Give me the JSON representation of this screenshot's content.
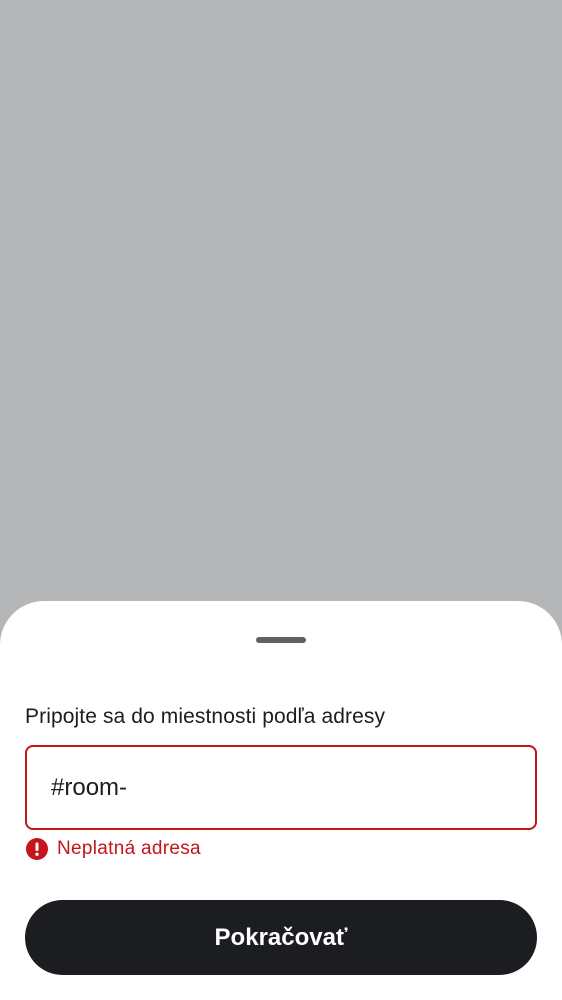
{
  "bottom_sheet": {
    "title": "Pripojte sa do miestnosti podľa adresy",
    "address_field": {
      "value": "#room-",
      "placeholder": ""
    },
    "error": {
      "icon": "error-icon",
      "message": "Neplatná adresa"
    },
    "continue_label": "Pokračovať"
  },
  "colors": {
    "scrim": "#b5b6b8",
    "sheet": "#ffffff",
    "error": "#c4141e",
    "primary_button": "#1b1d21",
    "text": "#1b1d21"
  }
}
